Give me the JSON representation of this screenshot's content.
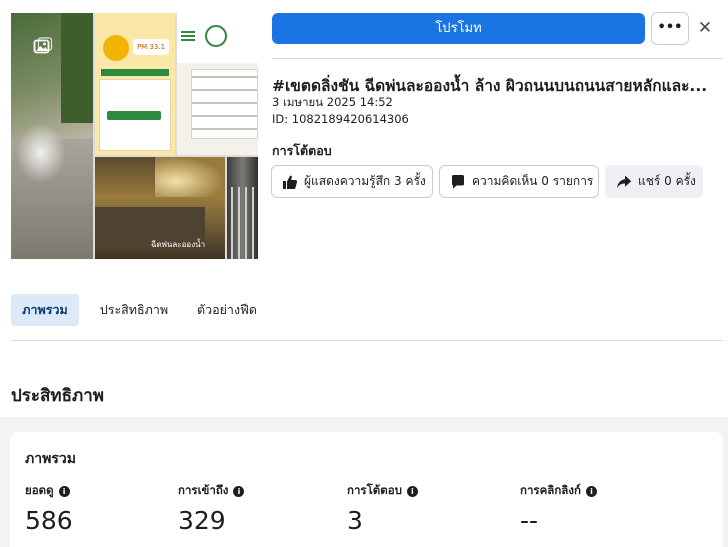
{
  "thumbnail": {
    "pm_reading": "PM 33.1",
    "caption": "ฉีดพ่นละอองน้ำ"
  },
  "toolbar": {
    "promote_label": "โปรโมท",
    "more_label": "•••",
    "close_label": "✕"
  },
  "post": {
    "title": "#เขตดลิ่งชัน ฉีดพ่นละอองน้ำ ล้าง ผิวถนนบนถนนสายหลักและ...",
    "date": "3 เมษายน 2025 14:52",
    "id": "ID: 1082189420614306"
  },
  "engagement": {
    "label": "การโต้ตอบ",
    "reactions": "ผู้แสดงความรู้สึก 3 ครั้ง",
    "comments": "ความคิดเห็น 0 รายการ",
    "shares": "แชร์ 0 ครั้ง"
  },
  "tabs": [
    {
      "label": "ภาพรวม",
      "active": true
    },
    {
      "label": "ประสิทธิภาพ",
      "active": false
    },
    {
      "label": "ตัวอย่างฟีด",
      "active": false
    }
  ],
  "performance": {
    "section_title": "ประสิทธิภาพ",
    "overview_title": "ภาพรวม",
    "metrics": [
      {
        "label": "ยอดดู",
        "value": "586"
      },
      {
        "label": "การเข้าถึง",
        "value": "329"
      },
      {
        "label": "การโต้ตอบ",
        "value": "3"
      },
      {
        "label": "การคลิกลิงก์",
        "value": "--"
      }
    ]
  },
  "colors": {
    "accent": "#1b74e4",
    "tab_active_bg": "#dde9f8"
  },
  "icons": {
    "image": "image-icon",
    "like": "like-icon",
    "comment": "comment-icon",
    "share": "share-icon",
    "info": "info-icon"
  }
}
